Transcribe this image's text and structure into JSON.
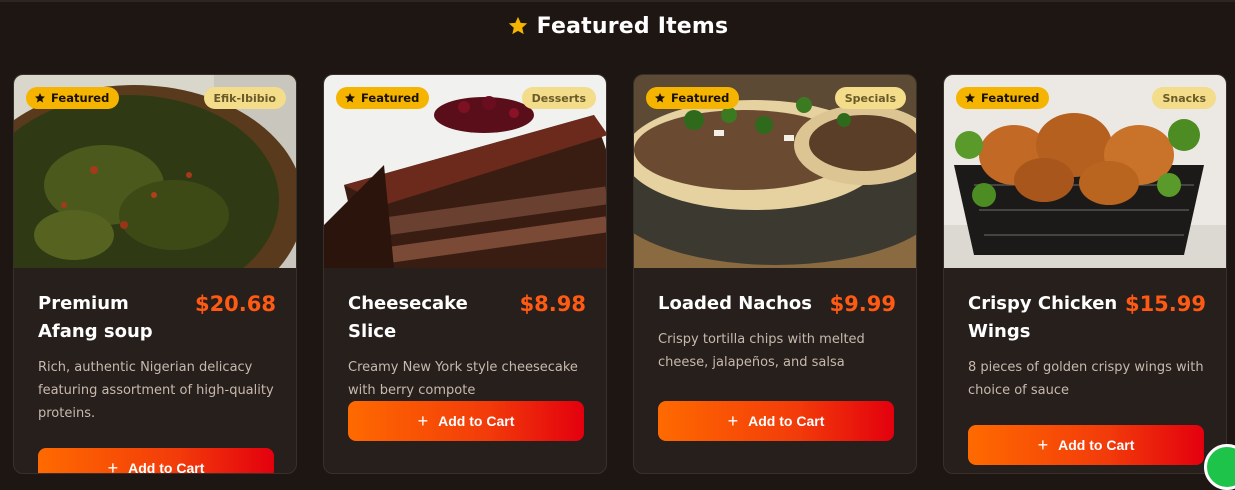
{
  "section": {
    "title": "Featured Items"
  },
  "badge_label": "Featured",
  "colors": {
    "accent": "#ff5a14",
    "featured_badge": "#f5b400",
    "category_badge": "#f3dc8a",
    "background": "#1e1613",
    "card": "#271f1c"
  },
  "icons": {
    "star": "star-icon",
    "plus": "plus-icon",
    "chat": "chat-icon"
  },
  "cards": [
    {
      "name": "Premium Afang soup",
      "price": "$20.68",
      "category": "Efik-Ibibio",
      "description": "Rich, authentic Nigerian delicacy featuring assortment of high-quality proteins.",
      "button_label": "Add to Cart"
    },
    {
      "name": "Cheesecake Slice",
      "price": "$8.98",
      "category": "Desserts",
      "description": "Creamy New York style cheesecake with berry compote",
      "button_label": "Add to Cart"
    },
    {
      "name": "Loaded Nachos",
      "price": "$9.99",
      "category": "Specials",
      "description": "Crispy tortilla chips with melted cheese, jalapeños, and salsa",
      "button_label": "Add to Cart"
    },
    {
      "name": "Crispy Chicken Wings",
      "price": "$15.99",
      "category": "Snacks",
      "description": "8 pieces of golden crispy wings with choice of sauce",
      "button_label": "Add to Cart"
    }
  ]
}
